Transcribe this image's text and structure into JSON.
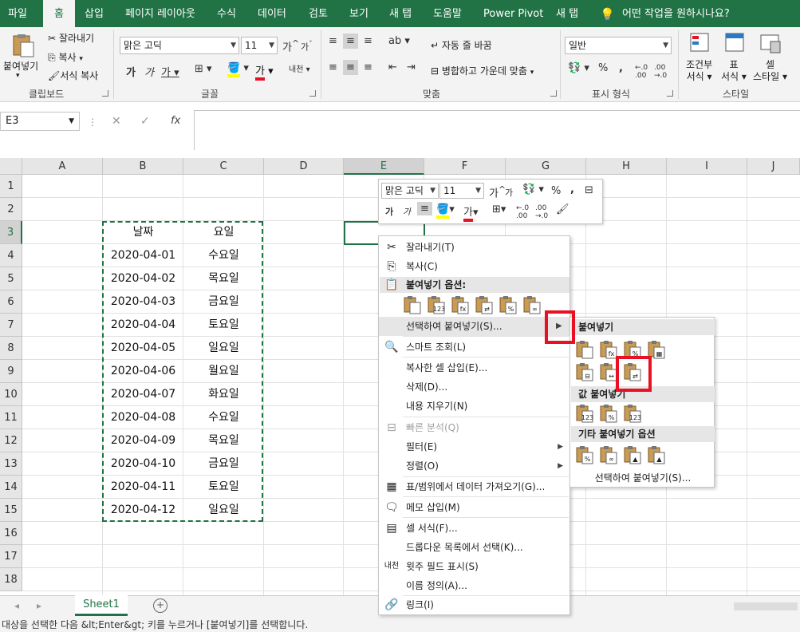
{
  "tabs": [
    "파일",
    "홈",
    "삽입",
    "페이지 레이아웃",
    "수식",
    "데이터",
    "검토",
    "보기",
    "새 탭",
    "도움말",
    "Power Pivot",
    "새 탭"
  ],
  "tell_me": "어떤 작업을 원하시나요?",
  "clipboard": {
    "paste": "붙여넣기",
    "cut": "잘라내기",
    "copy": "복사",
    "format_painter": "서식 복사",
    "label": "클립보드"
  },
  "font": {
    "name": "맑은 고딕",
    "size": "11",
    "label": "글꼴"
  },
  "align": {
    "wrap": "자동 줄 바꿈",
    "merge": "병합하고 가운데 맞춤",
    "label": "맞춤"
  },
  "number": {
    "format": "일반",
    "label": "표시 형식"
  },
  "styles": {
    "cond": "조건부 서식",
    "table": "표 서식",
    "cell": "셀 스타일",
    "label": "스타일",
    "cond1": "조건부",
    "cond2": "서식",
    "table1": "표",
    "table2": "서식",
    "cell1": "셀",
    "cell2": "스타일"
  },
  "namebox": "E3",
  "fx": "fx",
  "columns": [
    "A",
    "B",
    "C",
    "D",
    "E",
    "F",
    "G",
    "H",
    "I",
    "J"
  ],
  "rows": [
    "1",
    "2",
    "3",
    "4",
    "5",
    "6",
    "7",
    "8",
    "9",
    "10",
    "11",
    "12",
    "13",
    "14",
    "15",
    "16",
    "17",
    "18"
  ],
  "table": {
    "header": [
      "날짜",
      "요일"
    ],
    "rows": [
      [
        "2020-04-01",
        "수요일"
      ],
      [
        "2020-04-02",
        "목요일"
      ],
      [
        "2020-04-03",
        "금요일"
      ],
      [
        "2020-04-04",
        "토요일"
      ],
      [
        "2020-04-05",
        "일요일"
      ],
      [
        "2020-04-06",
        "월요일"
      ],
      [
        "2020-04-07",
        "화요일"
      ],
      [
        "2020-04-08",
        "수요일"
      ],
      [
        "2020-04-09",
        "목요일"
      ],
      [
        "2020-04-10",
        "금요일"
      ],
      [
        "2020-04-11",
        "토요일"
      ],
      [
        "2020-04-12",
        "일요일"
      ]
    ]
  },
  "sheet": "Sheet1",
  "status": "대상을 선택한 다음 &lt;Enter&gt; 키를 누르거나 [붙여넣기]를 선택합니다.",
  "mini": {
    "font": "맑은 고딕",
    "size": "11"
  },
  "menu": {
    "cut": "잘라내기(T)",
    "copy": "복사(C)",
    "paste_options": "붙여넣기 옵션:",
    "paste_special": "선택하여 붙여넣기(S)...",
    "smart_lookup": "스마트 조회(L)",
    "insert_copied": "복사한 셀 삽입(E)...",
    "delete": "삭제(D)...",
    "clear": "내용 지우기(N)",
    "quick_analysis": "빠른 분석(Q)",
    "filter": "필터(E)",
    "sort": "정렬(O)",
    "get_data": "표/범위에서 데이터 가져오기(G)...",
    "insert_comment": "메모 삽입(M)",
    "format_cells": "셀 서식(F)...",
    "pick_list": "드롭다운 목록에서 선택(K)...",
    "phonetic": "윗주 필드 표시(S)",
    "define_name": "이름 정의(A)...",
    "link": "링크(I)"
  },
  "submenu": {
    "paste": "붙여넣기",
    "paste_values": "값 붙여넣기",
    "other": "기타 붙여넣기 옵션",
    "paste_special": "선택하여 붙여넣기(S)..."
  },
  "colors": {
    "excel_green": "#217346",
    "highlight_red": "#e81123",
    "copy_border": "#217346"
  }
}
